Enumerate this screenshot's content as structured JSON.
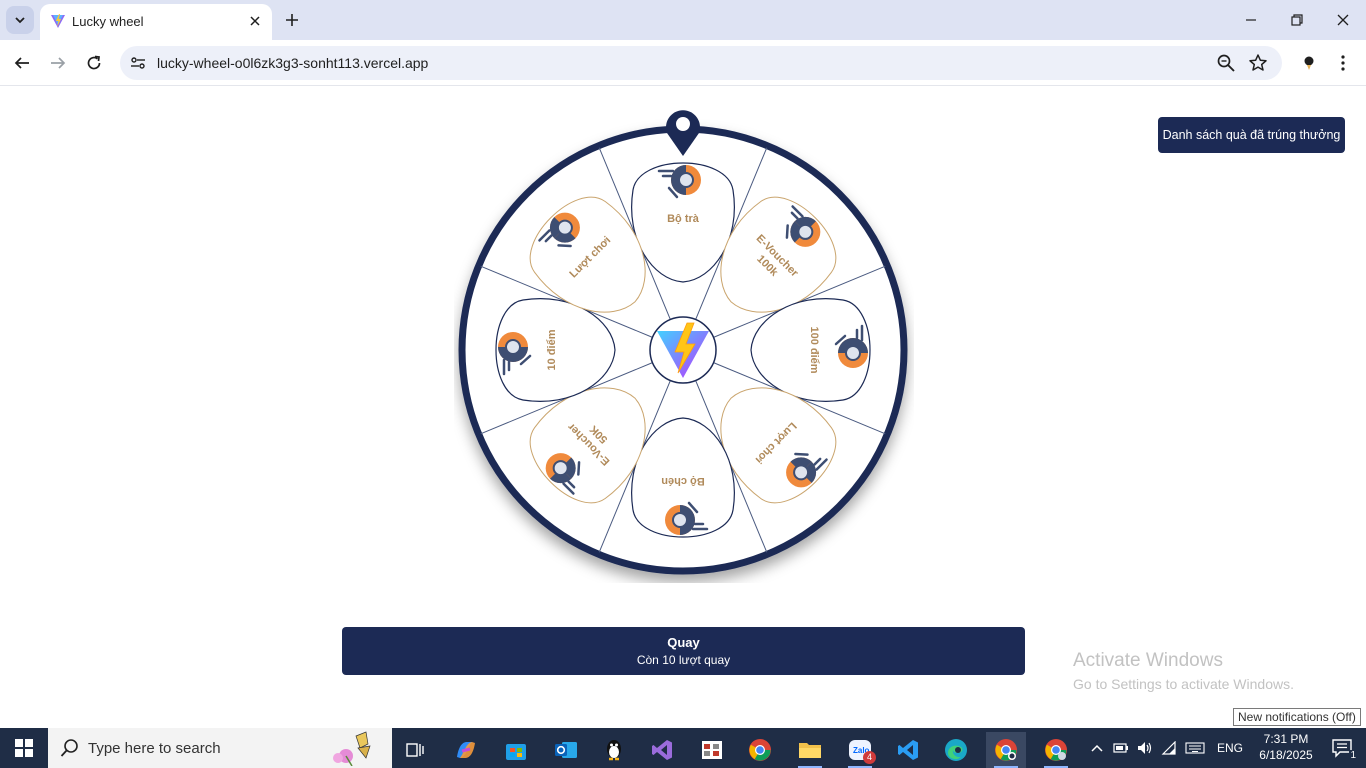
{
  "browser": {
    "tab_title": "Lucky wheel",
    "url": "lucky-wheel-o0l6zk3g3-sonht113.vercel.app"
  },
  "page": {
    "prize_list_button": "Danh sách quà đã trúng thưởng",
    "spin_button": {
      "label": "Quay",
      "remaining": "Còn 10 lượt quay"
    },
    "wheel_segments": [
      {
        "label": "Bộ trà",
        "style": "dark"
      },
      {
        "label": "E-Voucher 100k",
        "style": "gold"
      },
      {
        "label": "100 điểm",
        "style": "dark"
      },
      {
        "label": "Lượt chơi",
        "style": "gold"
      },
      {
        "label": "Bộ chén",
        "style": "dark"
      },
      {
        "label": "E-Voucher 50K",
        "style": "gold"
      },
      {
        "label": "10 điểm",
        "style": "dark"
      },
      {
        "label": "Lượt chơi",
        "style": "gold"
      }
    ],
    "colors": {
      "navy": "#1c2a55",
      "segment_dark_text": "#b08a5a",
      "segment_gold_border": "#caa56e",
      "icon_orange": "#f08a3c",
      "icon_blue": "#3e4e72"
    }
  },
  "overlay": {
    "activate_title": "Activate Windows",
    "activate_subtitle": "Go to Settings to activate Windows.",
    "notification_tooltip": "New notifications (Off)"
  },
  "taskbar": {
    "search_placeholder": "Type here to search",
    "apps": [
      "task-view",
      "copilot",
      "microsoft-store",
      "outlook",
      "qq",
      "visual-studio",
      "paint-app",
      "chrome",
      "file-explorer",
      "zalo",
      "vscode",
      "edge",
      "chrome-active",
      "chrome-profile"
    ],
    "zalo_badge": "4",
    "language": "ENG",
    "time": "7:31 PM",
    "date": "6/18/2025",
    "notification_count": "1"
  }
}
